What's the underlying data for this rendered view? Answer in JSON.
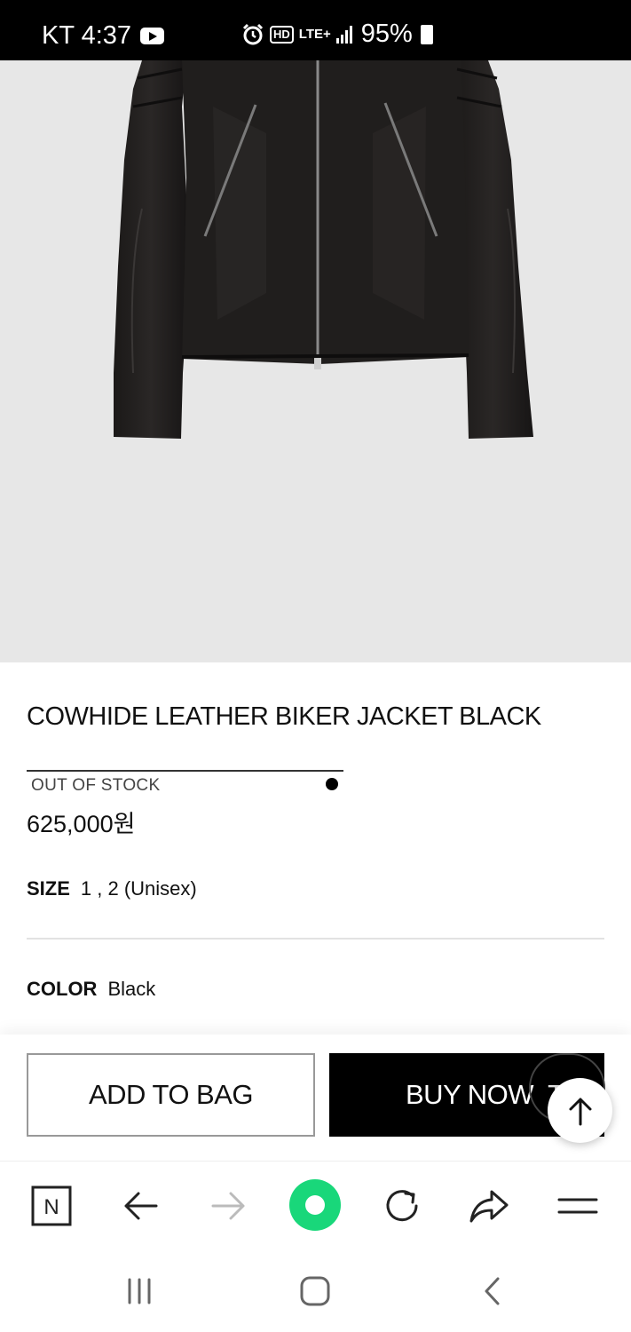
{
  "status_bar": {
    "carrier_time": "KT 4:37",
    "network": "LTE+",
    "hd_label": "HD",
    "battery": "95%"
  },
  "product": {
    "title": "COWHIDE LEATHER BIKER JACKET BLACK",
    "stock_status": "OUT OF STOCK",
    "price": "625,000원",
    "size_label": "SIZE",
    "size_value": "1 , 2 (Unisex)",
    "color_label": "COLOR",
    "color_value": "Black"
  },
  "actions": {
    "add_to_bag": "ADD TO BAG",
    "buy_now": "BUY NOW",
    "buy_now_overlay": "Ta"
  },
  "browser_toolbar": {
    "naver_label": "N",
    "accent_color": "#19d77a"
  },
  "icons": {
    "status": [
      "youtube-icon",
      "alarm-icon",
      "hd-icon",
      "lte-icon",
      "signal-icon",
      "battery-icon"
    ],
    "toolbar": [
      "naver-icon",
      "back-arrow-icon",
      "forward-arrow-icon",
      "green-dot-icon",
      "reload-icon",
      "share-icon",
      "menu-icon"
    ],
    "nav": [
      "recents-icon",
      "home-icon",
      "back-chevron-icon"
    ]
  }
}
